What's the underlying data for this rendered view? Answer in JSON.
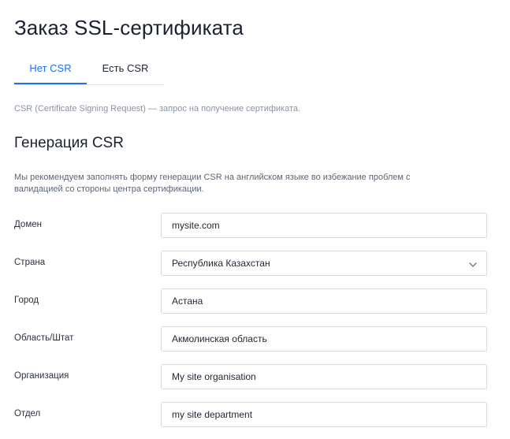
{
  "page": {
    "title": "Заказ SSL-сертификата"
  },
  "tabs": [
    {
      "label": "Нет CSR",
      "active": true
    },
    {
      "label": "Есть CSR",
      "active": false
    }
  ],
  "csr_note": "CSR (Certificate Signing Request) — запрос на получение сертификата.",
  "section": {
    "title": "Генерация CSR",
    "recommendation": "Мы рекомендуем заполнять форму генерации CSR на английском языке во избежание проблем с валидацией со стороны центра сертификации."
  },
  "form": {
    "domain": {
      "label": "Домен",
      "value": "mysite.com"
    },
    "country": {
      "label": "Страна",
      "value": "Республика Казахстан",
      "icon": "chevron-down-icon"
    },
    "city": {
      "label": "Город",
      "value": "Астана"
    },
    "region": {
      "label": "Область/Штат",
      "value": "Акмолинская область"
    },
    "organization": {
      "label": "Организация",
      "value": "My site organisation"
    },
    "department": {
      "label": "Отдел",
      "value": "my site department"
    }
  },
  "colors": {
    "accent": "#1e6ff0",
    "muted_text": "#8893a5",
    "border": "#d3d8e0"
  }
}
